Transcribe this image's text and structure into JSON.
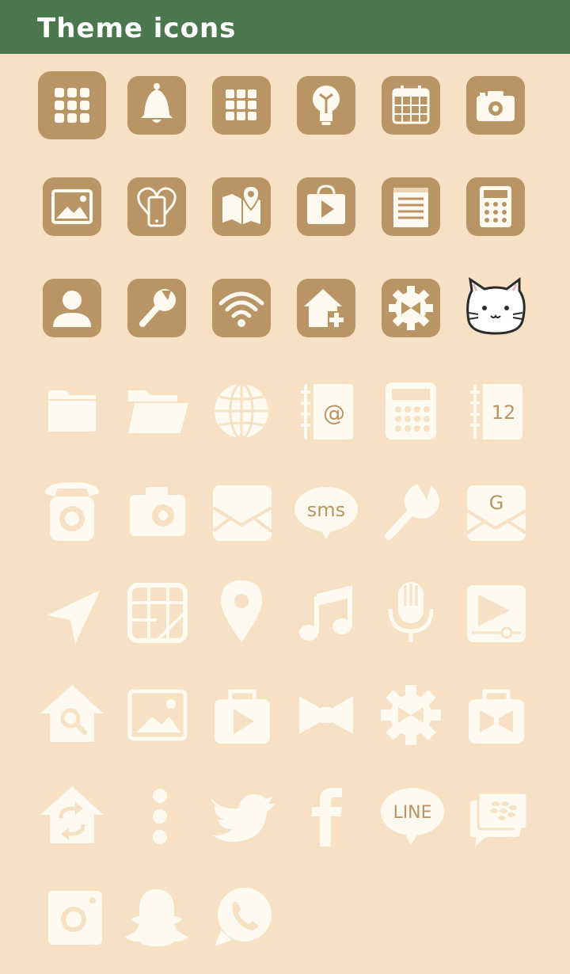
{
  "header": {
    "title": "Theme icons"
  },
  "colors": {
    "header_bg": "#4a774e",
    "page_bg": "#f6e1c4",
    "tile_bg": "#b99465",
    "glyph_light": "#fffaf0",
    "glyph_text": "#b99465"
  },
  "grid": {
    "row1": [
      "apps-grid-icon",
      "bell-icon",
      "apps-grid-icon",
      "lightbulb-icon",
      "calendar-icon",
      "camera-icon"
    ],
    "row2": [
      "gallery-icon",
      "heart-phone-icon",
      "map-icon",
      "play-store-icon",
      "notes-icon",
      "calculator-icon"
    ],
    "row3": [
      "contact-icon",
      "wrench-icon",
      "wifi-icon",
      "home-add-icon",
      "settings-gear-icon",
      "cat-face-icon"
    ],
    "row4": [
      "folder-icon",
      "folder-open-icon",
      "globe-icon",
      "email-contacts-icon",
      "calculator-icon",
      "calendar-book-icon"
    ],
    "row5": [
      "phone-icon",
      "camera-icon",
      "mail-icon",
      "sms-icon",
      "wrench-icon",
      "gmail-icon"
    ],
    "row6": [
      "navigation-icon",
      "maps-icon",
      "location-pin-icon",
      "music-icon",
      "microphone-icon",
      "video-player-icon"
    ],
    "row7": [
      "home-search-icon",
      "gallery-icon",
      "play-bag-icon",
      "bow-icon",
      "settings-gear-icon",
      "shop-bag-icon"
    ],
    "row8": [
      "home-sync-icon",
      "more-dots-icon",
      "twitter-icon",
      "facebook-icon",
      "line-icon",
      "blackberry-icon"
    ],
    "row9": [
      "instagram-icon",
      "snapchat-icon",
      "whatsapp-icon"
    ]
  },
  "labels": {
    "email_contacts": "@",
    "calendar_book": "12",
    "sms": "sms",
    "gmail": "G",
    "line": "LINE",
    "facebook": "f"
  }
}
